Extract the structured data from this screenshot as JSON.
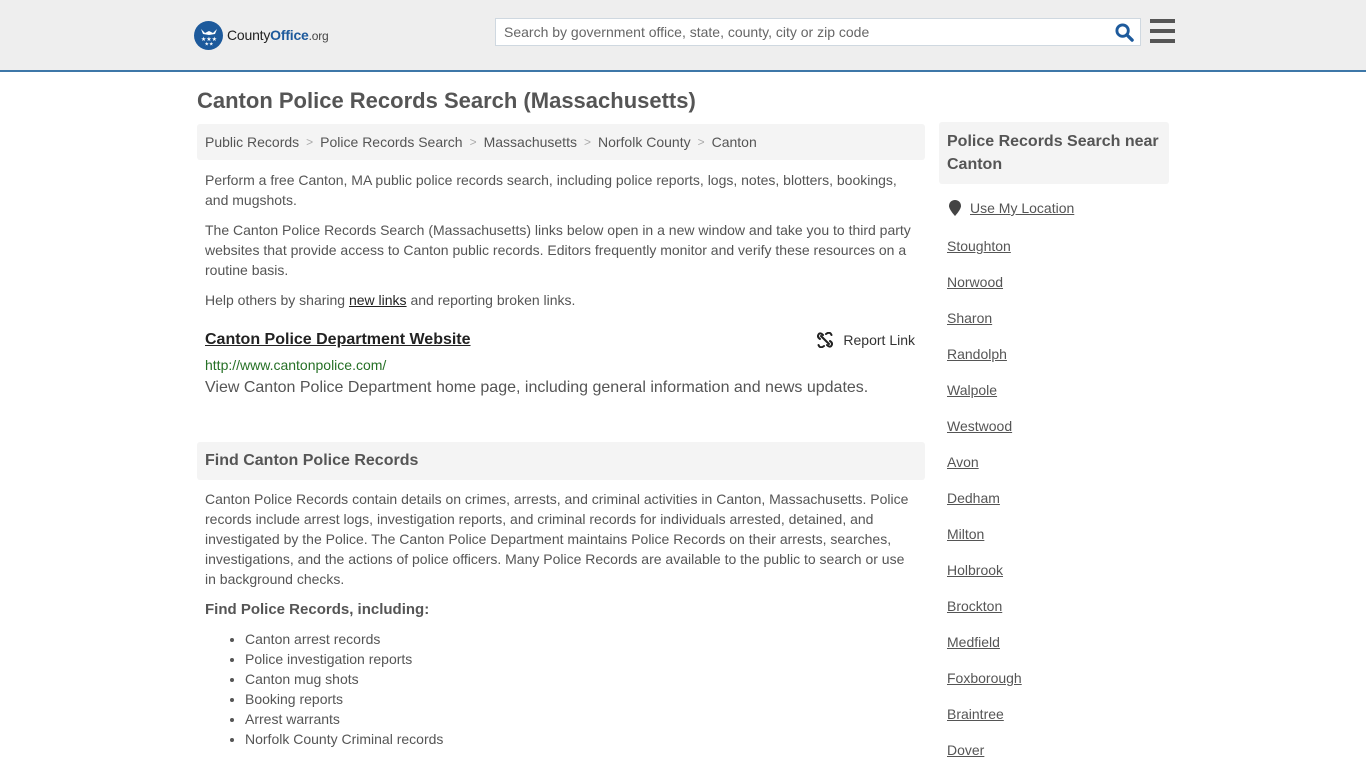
{
  "header": {
    "logo": {
      "name_part1": "County",
      "name_part2": "Office",
      "tld": ".org",
      "icon": "eagle-stars-badge-icon"
    },
    "search": {
      "placeholder": "Search by government office, state, county, city or zip code",
      "value": ""
    },
    "colors": {
      "brand_blue": "#1d5a9c",
      "header_bg": "#eeeeee",
      "header_border": "#3d77a8"
    }
  },
  "page": {
    "title": "Canton Police Records Search (Massachusetts)",
    "breadcrumb": [
      "Public Records",
      "Police Records Search",
      "Massachusetts",
      "Norfolk County",
      "Canton"
    ],
    "intro": {
      "p1": "Perform a free Canton, MA public police records search, including police reports, logs, notes, blotters, bookings, and mugshots.",
      "p2": "The Canton Police Records Search (Massachusetts) links below open in a new window and take you to third party websites that provide access to Canton public records. Editors frequently monitor and verify these resources on a routine basis.",
      "p3_before": "Help others by sharing ",
      "p3_link": "new links",
      "p3_after": " and reporting broken links."
    },
    "links": [
      {
        "title": "Canton Police Department Website",
        "url": "http://www.cantonpolice.com/",
        "description": "View Canton Police Department home page, including general information and news updates.",
        "report_label": "Report Link"
      }
    ],
    "find_section": {
      "heading": "Find Canton Police Records",
      "body": "Canton Police Records contain details on crimes, arrests, and criminal activities in Canton, Massachusetts. Police records include arrest logs, investigation reports, and criminal records for individuals arrested, detained, and investigated by the Police. The Canton Police Department maintains Police Records on their arrests, searches, investigations, and the actions of police officers. Many Police Records are available to the public to search or use in background checks.",
      "subheading": "Find Police Records, including:",
      "items": [
        "Canton arrest records",
        "Police investigation reports",
        "Canton mug shots",
        "Booking reports",
        "Arrest warrants",
        "Norfolk County Criminal records"
      ]
    }
  },
  "sidebar": {
    "heading": "Police Records Search near Canton",
    "use_location": "Use My Location",
    "nearby": [
      "Stoughton",
      "Norwood",
      "Sharon",
      "Randolph",
      "Walpole",
      "Westwood",
      "Avon",
      "Dedham",
      "Milton",
      "Holbrook",
      "Brockton",
      "Medfield",
      "Foxborough",
      "Braintree",
      "Dover"
    ]
  }
}
